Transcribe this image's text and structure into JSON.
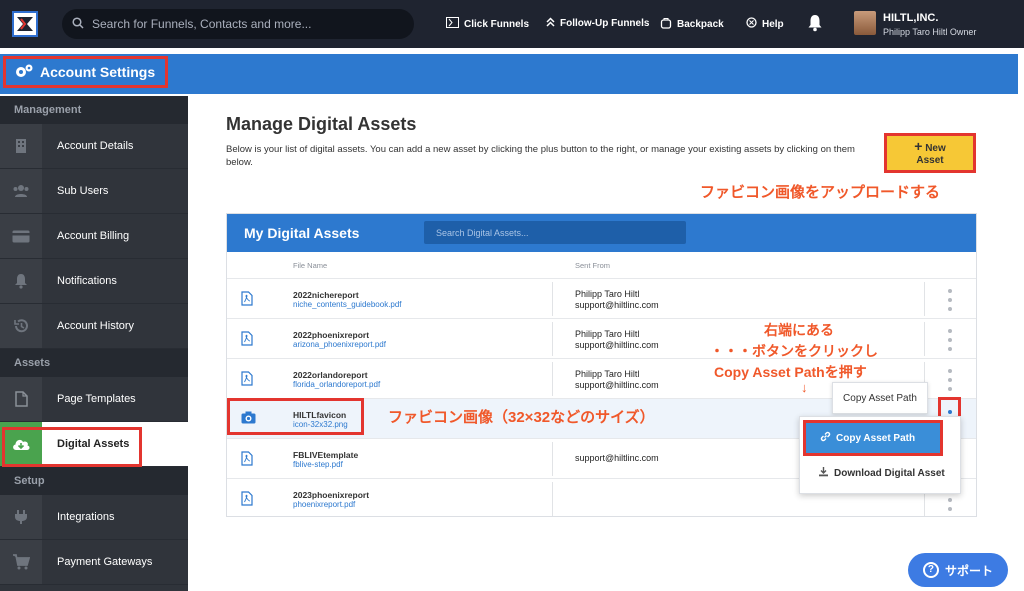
{
  "topbar": {
    "search_placeholder": "Search for Funnels, Contacts and more...",
    "nav": [
      {
        "label": "Click Funnels",
        "icon": "clickfunnels-icon"
      },
      {
        "label": "Follow-Up Funnels",
        "icon": "double-chevron-up-icon"
      },
      {
        "label": "Backpack",
        "icon": "backpack-icon"
      },
      {
        "label": "Help",
        "icon": "help-icon"
      }
    ],
    "user": {
      "company": "HILTL,INC.",
      "name_role": "Philipp Taro Hiltl   Owner"
    }
  },
  "header": {
    "title": "Account Settings"
  },
  "sidebar": {
    "sections": [
      {
        "title": "Management",
        "items": [
          {
            "label": "Account Details",
            "icon": "building-icon"
          },
          {
            "label": "Sub Users",
            "icon": "users-icon"
          },
          {
            "label": "Account Billing",
            "icon": "credit-card-icon"
          },
          {
            "label": "Notifications",
            "icon": "bell-icon"
          },
          {
            "label": "Account History",
            "icon": "history-icon"
          }
        ]
      },
      {
        "title": "Assets",
        "items": [
          {
            "label": "Page Templates",
            "icon": "file-icon"
          },
          {
            "label": "Digital Assets",
            "icon": "cloud-download-icon",
            "active": true
          }
        ]
      },
      {
        "title": "Setup",
        "items": [
          {
            "label": "Integrations",
            "icon": "plug-icon"
          },
          {
            "label": "Payment Gateways",
            "icon": "cart-icon"
          }
        ]
      }
    ]
  },
  "main": {
    "title": "Manage Digital Assets",
    "description": "Below is your list of digital assets. You can add a new asset by clicking the plus button to the right, or manage your existing assets by clicking on them below.",
    "new_asset_label_1": "New",
    "new_asset_label_2": "Asset",
    "panel": {
      "title": "My Digital Assets",
      "search_placeholder": "Search Digital Assets...",
      "col_file": "File Name",
      "col_sent": "Sent From",
      "rows": [
        {
          "name": "2022nichereport",
          "file": "niche_contents_guidebook.pdf",
          "sender_name": "Philipp Taro Hiltl",
          "sender_email": "support@hiltlinc.com",
          "icon": "pdf-file-icon"
        },
        {
          "name": "2022phoenixreport",
          "file": "arizona_phoenixreport.pdf",
          "sender_name": "Philipp Taro Hiltl",
          "sender_email": "support@hiltlinc.com",
          "icon": "pdf-file-icon"
        },
        {
          "name": "2022orlandoreport",
          "file": "florida_orlandoreport.pdf",
          "sender_name": "Philipp Taro Hiltl",
          "sender_email": "support@hiltlinc.com",
          "icon": "pdf-file-icon"
        },
        {
          "name": "HILTLfavicon",
          "file": "icon-32x32.png",
          "sender_name": "",
          "sender_email": "",
          "icon": "camera-icon"
        },
        {
          "name": "FBLIVEtemplate",
          "file": "fblive-step.pdf",
          "sender_name": "",
          "sender_email": "support@hiltlinc.com",
          "icon": "pdf-file-icon"
        },
        {
          "name": "2023phoenixreport",
          "file": "phoenixreport.pdf",
          "sender_name": "",
          "sender_email": "",
          "icon": "pdf-file-icon"
        }
      ]
    },
    "tooltip": "Copy Asset Path",
    "menu": {
      "copy": "Copy Asset Path",
      "download": "Download Digital Asset"
    }
  },
  "annotations": {
    "upload": "ファビコン画像をアップロードする",
    "favicon": "ファビコン画像（32×32などのサイズ）",
    "instr_line1": "右端にある",
    "instr_line2": "・・・ボタンをクリックし",
    "instr_line3": "Copy Asset Pathを押す",
    "arrow": "↓"
  },
  "support": {
    "label": "サポート"
  },
  "colors": {
    "accent_blue": "#2d79cf",
    "highlight_red": "#e3352f",
    "annotation_orange": "#f0582a",
    "button_yellow": "#f6c836"
  }
}
